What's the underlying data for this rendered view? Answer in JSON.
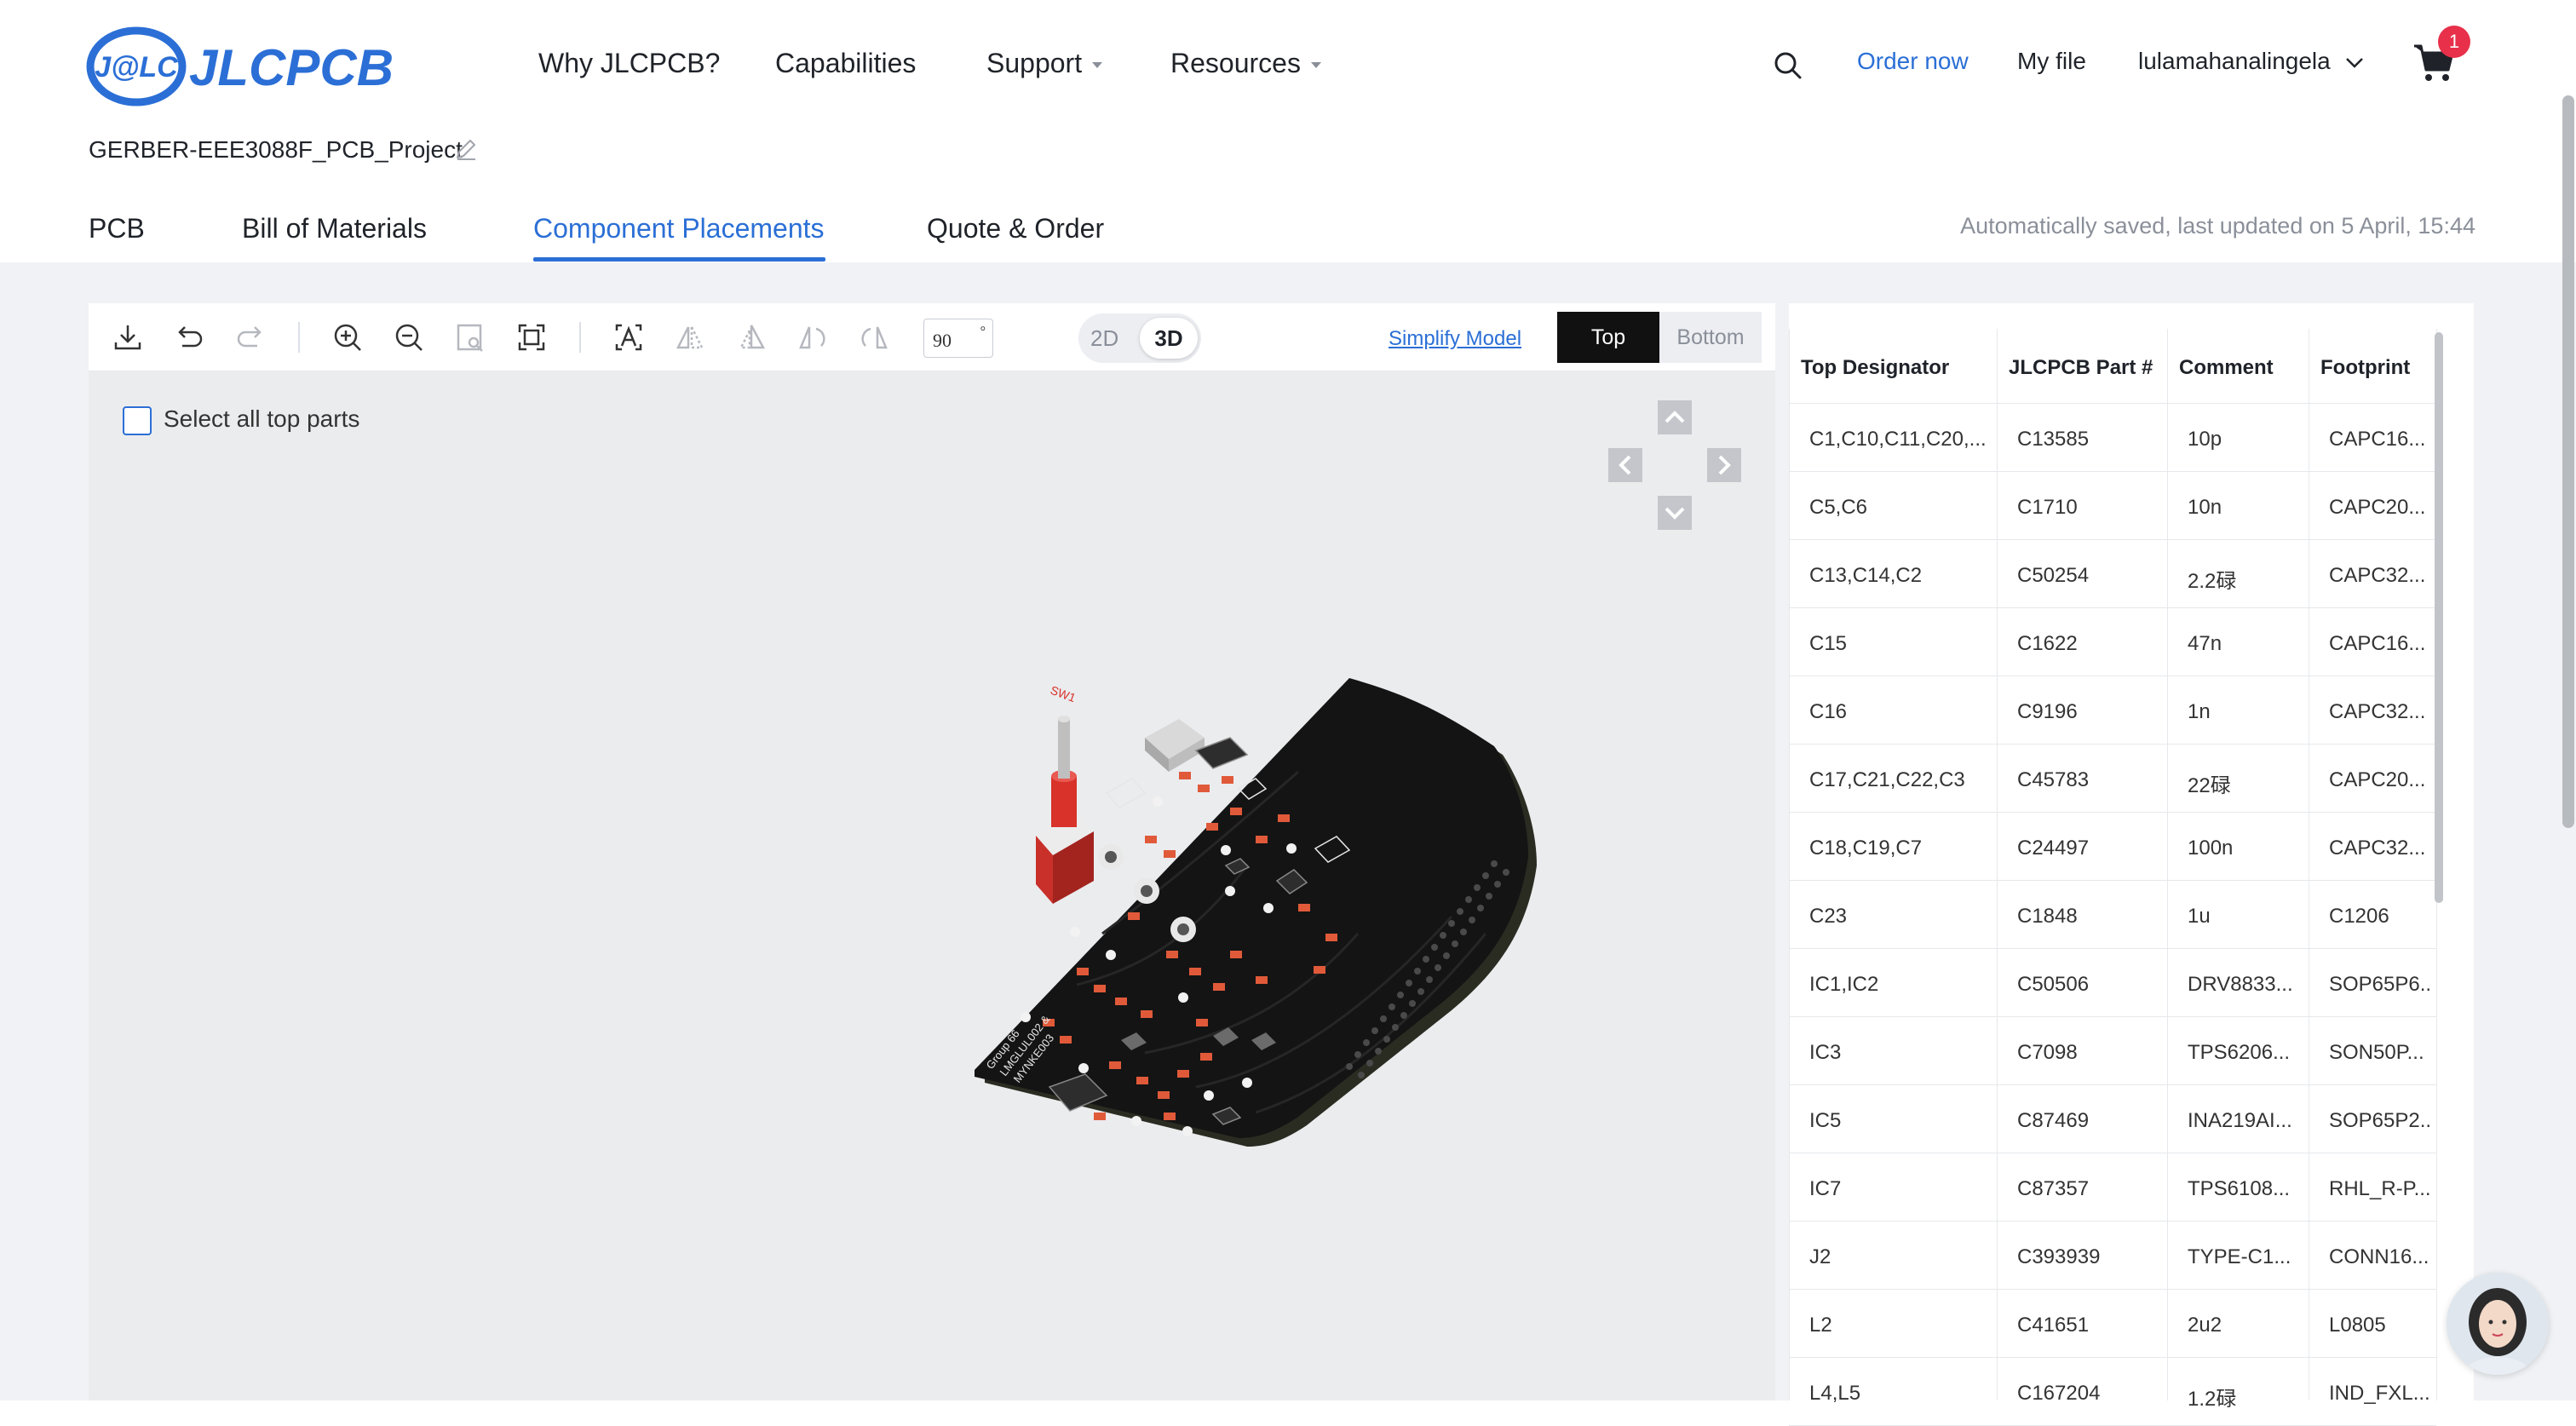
{
  "brand": {
    "name": "JLCPCB",
    "mark": "J@LC"
  },
  "nav": [
    {
      "label": "Why JLCPCB?",
      "dropdown": false
    },
    {
      "label": "Capabilities",
      "dropdown": false
    },
    {
      "label": "Support",
      "dropdown": true
    },
    {
      "label": "Resources",
      "dropdown": true
    }
  ],
  "header_right": {
    "order_now": "Order now",
    "my_file": "My file",
    "username": "lulamahanalingela",
    "cart_count": "1"
  },
  "project": {
    "name": "GERBER-EEE3088F_PCB_Project"
  },
  "tabs": [
    {
      "label": "PCB",
      "active": false
    },
    {
      "label": "Bill of Materials",
      "active": false
    },
    {
      "label": "Component Placements",
      "active": true
    },
    {
      "label": "Quote & Order",
      "active": false
    }
  ],
  "autosave_text": "Automatically saved, last updated on 5 April, 15:44",
  "toolbar": {
    "rotation_angle": "90",
    "rotation_unit": "°",
    "view_2d": "2D",
    "view_3d": "3D",
    "active_view": "3D",
    "simplify_model": "Simplify Model",
    "side_top": "Top",
    "side_bottom": "Bottom",
    "active_side": "Top",
    "icons": [
      "download-icon",
      "undo-icon",
      "redo-icon",
      "zoom-in-icon",
      "zoom-out-icon",
      "zoom-area-icon",
      "fit-view-icon",
      "text-icon",
      "mirror-horizontal-icon",
      "mirror-vertical-icon",
      "rotate-left-icon",
      "rotate-right-icon"
    ]
  },
  "canvas": {
    "select_all_label": "Select all top parts",
    "board_silkscreen": {
      "group": "Group 66",
      "names": "LMGLUL002 &",
      "code": "MYNKE003",
      "switch": "SW1"
    }
  },
  "colors": {
    "accent": "#2b6fd6",
    "badge": "#e8304a",
    "pcb": "#141414",
    "component_red": "#d8322a"
  },
  "parts_table": {
    "columns": [
      "Top Designator",
      "JLCPCB Part #",
      "Comment",
      "Footprint"
    ],
    "rows": [
      [
        "C1,C10,C11,C20,...",
        "C13585",
        "10p",
        "CAPC16..."
      ],
      [
        "C5,C6",
        "C1710",
        "10n",
        "CAPC20..."
      ],
      [
        "C13,C14,C2",
        "C50254",
        "2.2碌",
        "CAPC32..."
      ],
      [
        "C15",
        "C1622",
        "47n",
        "CAPC16..."
      ],
      [
        "C16",
        "C9196",
        "1n",
        "CAPC32..."
      ],
      [
        "C17,C21,C22,C3",
        "C45783",
        "22碌",
        "CAPC20..."
      ],
      [
        "C18,C19,C7",
        "C24497",
        "100n",
        "CAPC32..."
      ],
      [
        "C23",
        "C1848",
        "1u",
        "C1206"
      ],
      [
        "IC1,IC2",
        "C50506",
        "DRV8833...",
        "SOP65P6..."
      ],
      [
        "IC3",
        "C7098",
        "TPS6206...",
        "SON50P..."
      ],
      [
        "IC5",
        "C87469",
        "INA219AI...",
        "SOP65P2..."
      ],
      [
        "IC7",
        "C87357",
        "TPS6108...",
        "RHL_R-P..."
      ],
      [
        "J2",
        "C393939",
        "TYPE-C1...",
        "CONN16..."
      ],
      [
        "L2",
        "C41651",
        "2u2",
        "L0805"
      ],
      [
        "L4,L5",
        "C167204",
        "1.2碌",
        "IND_FXL..."
      ]
    ]
  }
}
